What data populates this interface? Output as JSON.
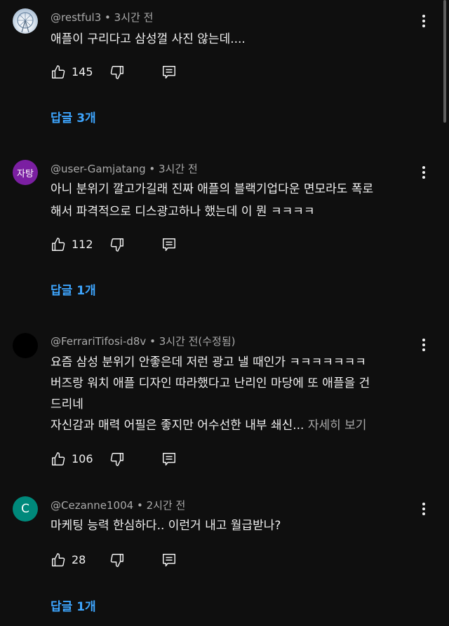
{
  "comments": [
    {
      "author": "@restful3",
      "time": "3시간 전",
      "text": [
        "애플이 구리다고 삼성껄 사진 않는데...."
      ],
      "likes": "145",
      "replies_label": "답글 3개",
      "avatar_icon": "ferris-wheel-photo"
    },
    {
      "author": "@user-Gamjatang",
      "time": "3시간 전",
      "avatar_text": "자탕",
      "avatar_color": "#7b1fa2",
      "text": [
        "아니 분위기 깔고가길래 진짜 애플의 블랙기업다운 면모라도 폭로",
        "해서 파격적으로 디스광고하나 했는데 이 뭔 ㅋㅋㅋㅋ"
      ],
      "likes": "112",
      "replies_label": "답글 1개"
    },
    {
      "author": "@FerrariTifosi-d8v",
      "time": "3시간 전(수정됨)",
      "avatar_color": "#000000",
      "text": [
        "요즘 삼성 분위기 안좋은데 저런 광고 낼 때인가 ㅋㅋㅋㅋㅋㅋㅋ",
        "버즈랑 워치 애플 디자인 따라했다고 난리인 마당에 또 애플을 건",
        "드리네",
        "자신감과 매력 어필은 좋지만 어수선한 내부 쇄신..."
      ],
      "more_label": "자세히 보기",
      "likes": "106"
    },
    {
      "author": "@Cezanne1004",
      "time": "2시간 전",
      "avatar_text": "C",
      "avatar_color": "#00897b",
      "text": [
        "마케팅 능력 한심하다.. 이런거 내고 월급받나?"
      ],
      "likes": "28",
      "replies_label": "답글 1개"
    }
  ],
  "colors": {
    "background": "#0f0f0f",
    "link": "#3ea6ff",
    "secondary_text": "#aaaaaa"
  }
}
